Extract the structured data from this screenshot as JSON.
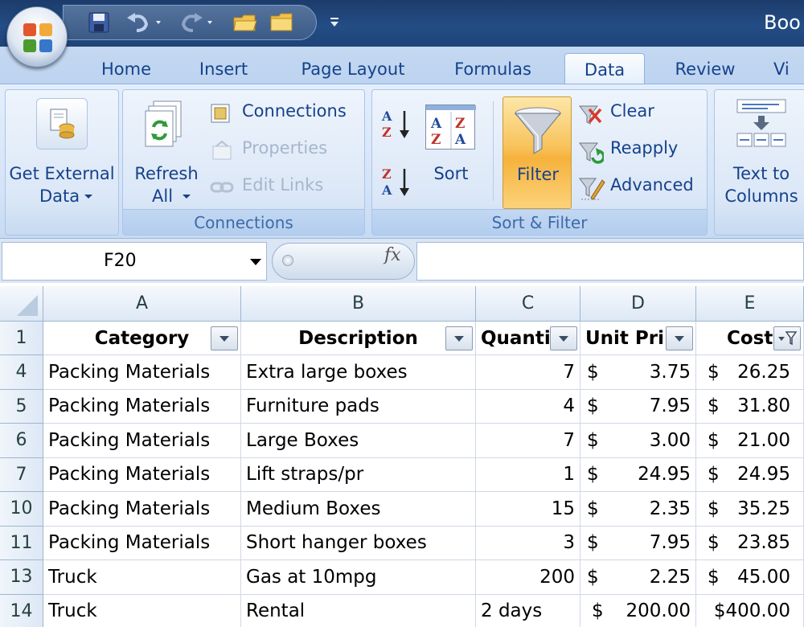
{
  "window": {
    "title_partial": "Boo"
  },
  "tabs": [
    {
      "label": "Home",
      "active": false
    },
    {
      "label": "Insert",
      "active": false
    },
    {
      "label": "Page Layout",
      "active": false
    },
    {
      "label": "Formulas",
      "active": false
    },
    {
      "label": "Data",
      "active": true
    },
    {
      "label": "Review",
      "active": false
    },
    {
      "label": "Vi",
      "active": false
    }
  ],
  "ribbon": {
    "get_external": {
      "line1": "Get External",
      "line2": "Data"
    },
    "connections_group": {
      "label": "Connections",
      "refresh_line1": "Refresh",
      "refresh_line2": "All",
      "connections": "Connections",
      "properties": "Properties",
      "edit_links": "Edit Links"
    },
    "sort_filter_group": {
      "label": "Sort & Filter",
      "sort": "Sort",
      "filter": "Filter",
      "clear": "Clear",
      "reapply": "Reapply",
      "advanced": "Advanced"
    },
    "text_to_columns": {
      "line1": "Text to",
      "line2": "Columns"
    }
  },
  "formula_bar": {
    "name_box": "F20",
    "fx_symbol": "fx",
    "formula": ""
  },
  "grid": {
    "columns": [
      "A",
      "B",
      "C",
      "D",
      "E"
    ],
    "header_row": {
      "row_num": "1",
      "cells": [
        "Category",
        "Description",
        "Quanti",
        "Unit Pri",
        "Cost"
      ]
    },
    "rows": [
      {
        "num": "4",
        "a": "Packing Materials",
        "b": "Extra large boxes",
        "c": "7",
        "d_sym": "$",
        "d": "3.75",
        "e_sym": "$",
        "e": "26.25"
      },
      {
        "num": "5",
        "a": "Packing Materials",
        "b": "Furniture pads",
        "c": "4",
        "d_sym": "$",
        "d": "7.95",
        "e_sym": "$",
        "e": "31.80"
      },
      {
        "num": "6",
        "a": "Packing Materials",
        "b": "Large Boxes",
        "c": "7",
        "d_sym": "$",
        "d": "3.00",
        "e_sym": "$",
        "e": "21.00"
      },
      {
        "num": "7",
        "a": "Packing Materials",
        "b": "Lift straps/pr",
        "c": "1",
        "d_sym": "$",
        "d": "24.95",
        "e_sym": "$",
        "e": "24.95"
      },
      {
        "num": "10",
        "a": "Packing Materials",
        "b": "Medium Boxes",
        "c": "15",
        "d_sym": "$",
        "d": "2.35",
        "e_sym": "$",
        "e": "35.25"
      },
      {
        "num": "11",
        "a": "Packing Materials",
        "b": "Short hanger boxes",
        "c": "3",
        "d_sym": "$",
        "d": "7.95",
        "e_sym": "$",
        "e": "23.85"
      },
      {
        "num": "13",
        "a": "Truck",
        "b": "Gas at 10mpg",
        "c": "200",
        "d_sym": "$",
        "d": "2.25",
        "e_sym": "$",
        "e": "45.00"
      },
      {
        "num": "14",
        "a": "Truck",
        "b": "Rental",
        "c": "2 days",
        "d_sym": "$",
        "d": "200.00",
        "e_sym": "",
        "e": "$400.00"
      }
    ]
  },
  "colors": {
    "title_bar": "#1f4478",
    "ribbon": "#d4e3f6",
    "filter_active": "#f8c25a",
    "tab_text": "#15428b"
  }
}
